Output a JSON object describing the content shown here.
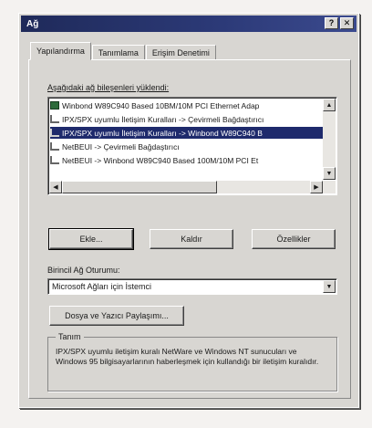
{
  "window": {
    "title": "Ağ"
  },
  "title_buttons": {
    "help": "?",
    "close": "✕"
  },
  "tabs": [
    {
      "label": "Yapılandırma",
      "active": true
    },
    {
      "label": "Tanımlama",
      "active": false
    },
    {
      "label": "Erişim Denetimi",
      "active": false
    }
  ],
  "components": {
    "label": "Aşağıdaki ağ bileşenleri yüklendi:",
    "items": [
      {
        "icon": "network-adapter-icon",
        "text": "Winbond W89C940 Based 10BM/10M PCI Ethernet Adap",
        "selected": false
      },
      {
        "icon": "protocol-icon",
        "text": "IPX/SPX uyumlu İletişim Kuralları -> Çevirmeli Bağdaştırıcı",
        "selected": false
      },
      {
        "icon": "protocol-icon",
        "text": "IPX/SPX uyumlu İletişim Kuralları -> Winbond W89C940 B",
        "selected": true
      },
      {
        "icon": "protocol-icon",
        "text": "NetBEUI -> Çevirmeli Bağdaştırıcı",
        "selected": false
      },
      {
        "icon": "protocol-icon",
        "text": "NetBEUI -> Winbond W89C940 Based 100M/10M PCI Et",
        "selected": false
      }
    ]
  },
  "buttons": {
    "add": "Ekle...",
    "remove": "Kaldır",
    "properties": "Özellikler"
  },
  "primary_logon": {
    "label": "Birincil Ağ Oturumu:",
    "value": "Microsoft Ağları için İstemci"
  },
  "file_print_sharing": {
    "label": "Dosya ve Yazıcı Paylaşımı..."
  },
  "description": {
    "legend": "Tanım",
    "text": "IPX/SPX uyumlu iletişim kuralı NetWare ve Windows NT sunucuları ve Windows 95 bilgisayarlarının haberleşmek için kullandığı bir iletişim kuralıdır."
  }
}
